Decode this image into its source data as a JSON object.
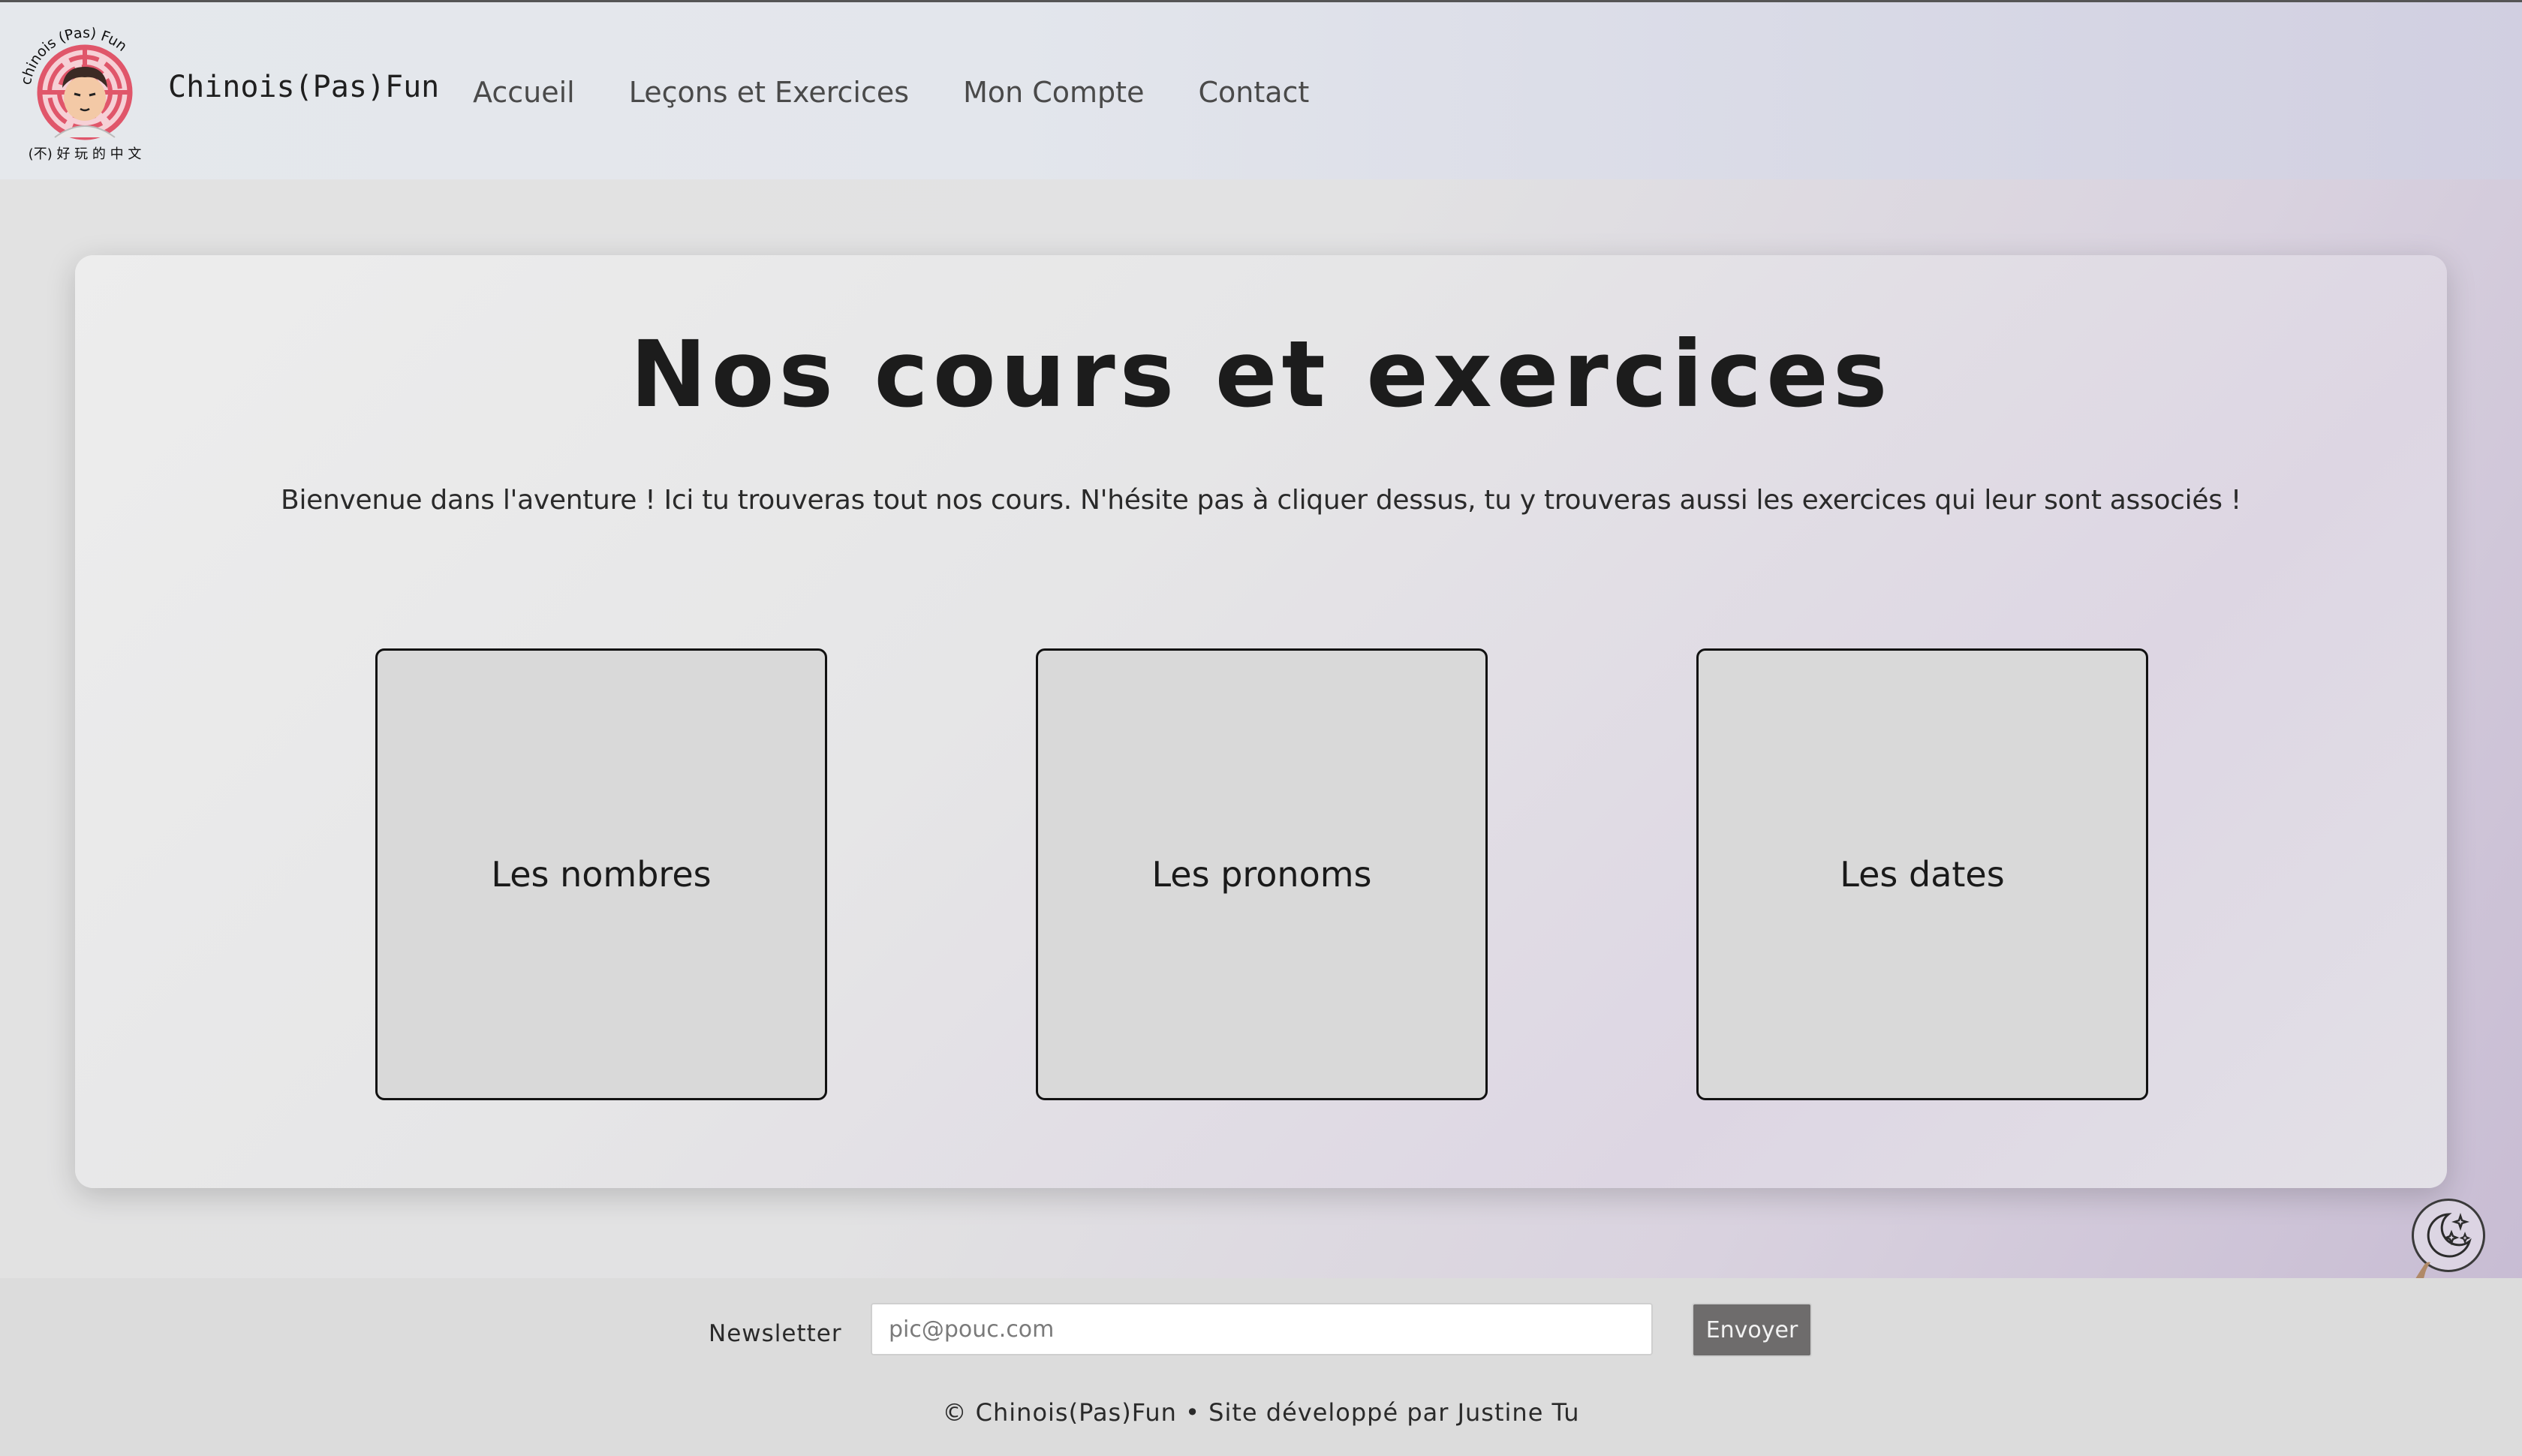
{
  "brand": {
    "logo_text_top": "chinois (Pas) Fun",
    "logo_text_bottom": "(不) 好 玩 的 中 文",
    "name": "Chinois(Pas)Fun"
  },
  "nav": {
    "items": [
      {
        "label": "Accueil"
      },
      {
        "label": "Leçons et Exercices"
      },
      {
        "label": "Mon Compte"
      },
      {
        "label": "Contact"
      }
    ]
  },
  "main": {
    "title": "Nos cours et exercices",
    "intro": "Bienvenue dans l'aventure ! Ici tu trouveras tout nos cours. N'hésite pas à cliquer dessus, tu y trouveras aussi les exercices qui leur sont associés !",
    "courses": [
      {
        "label": "Les nombres"
      },
      {
        "label": "Les pronoms"
      },
      {
        "label": "Les dates"
      }
    ]
  },
  "theme_toggle": {
    "icon": "moon-stars-icon"
  },
  "footer": {
    "newsletter_label": "Newsletter",
    "newsletter_placeholder": "pic@pouc.com",
    "newsletter_button": "Envoyer",
    "copyright": "© Chinois(Pas)Fun • Site développé par Justine Tu"
  },
  "colors": {
    "header_bg": "#e3e6ec",
    "card_bg": "#d9d9d9",
    "button_bg": "#6e6c6c",
    "footer_bg": "#dcdcdc",
    "logo_red": "#e0566a"
  }
}
